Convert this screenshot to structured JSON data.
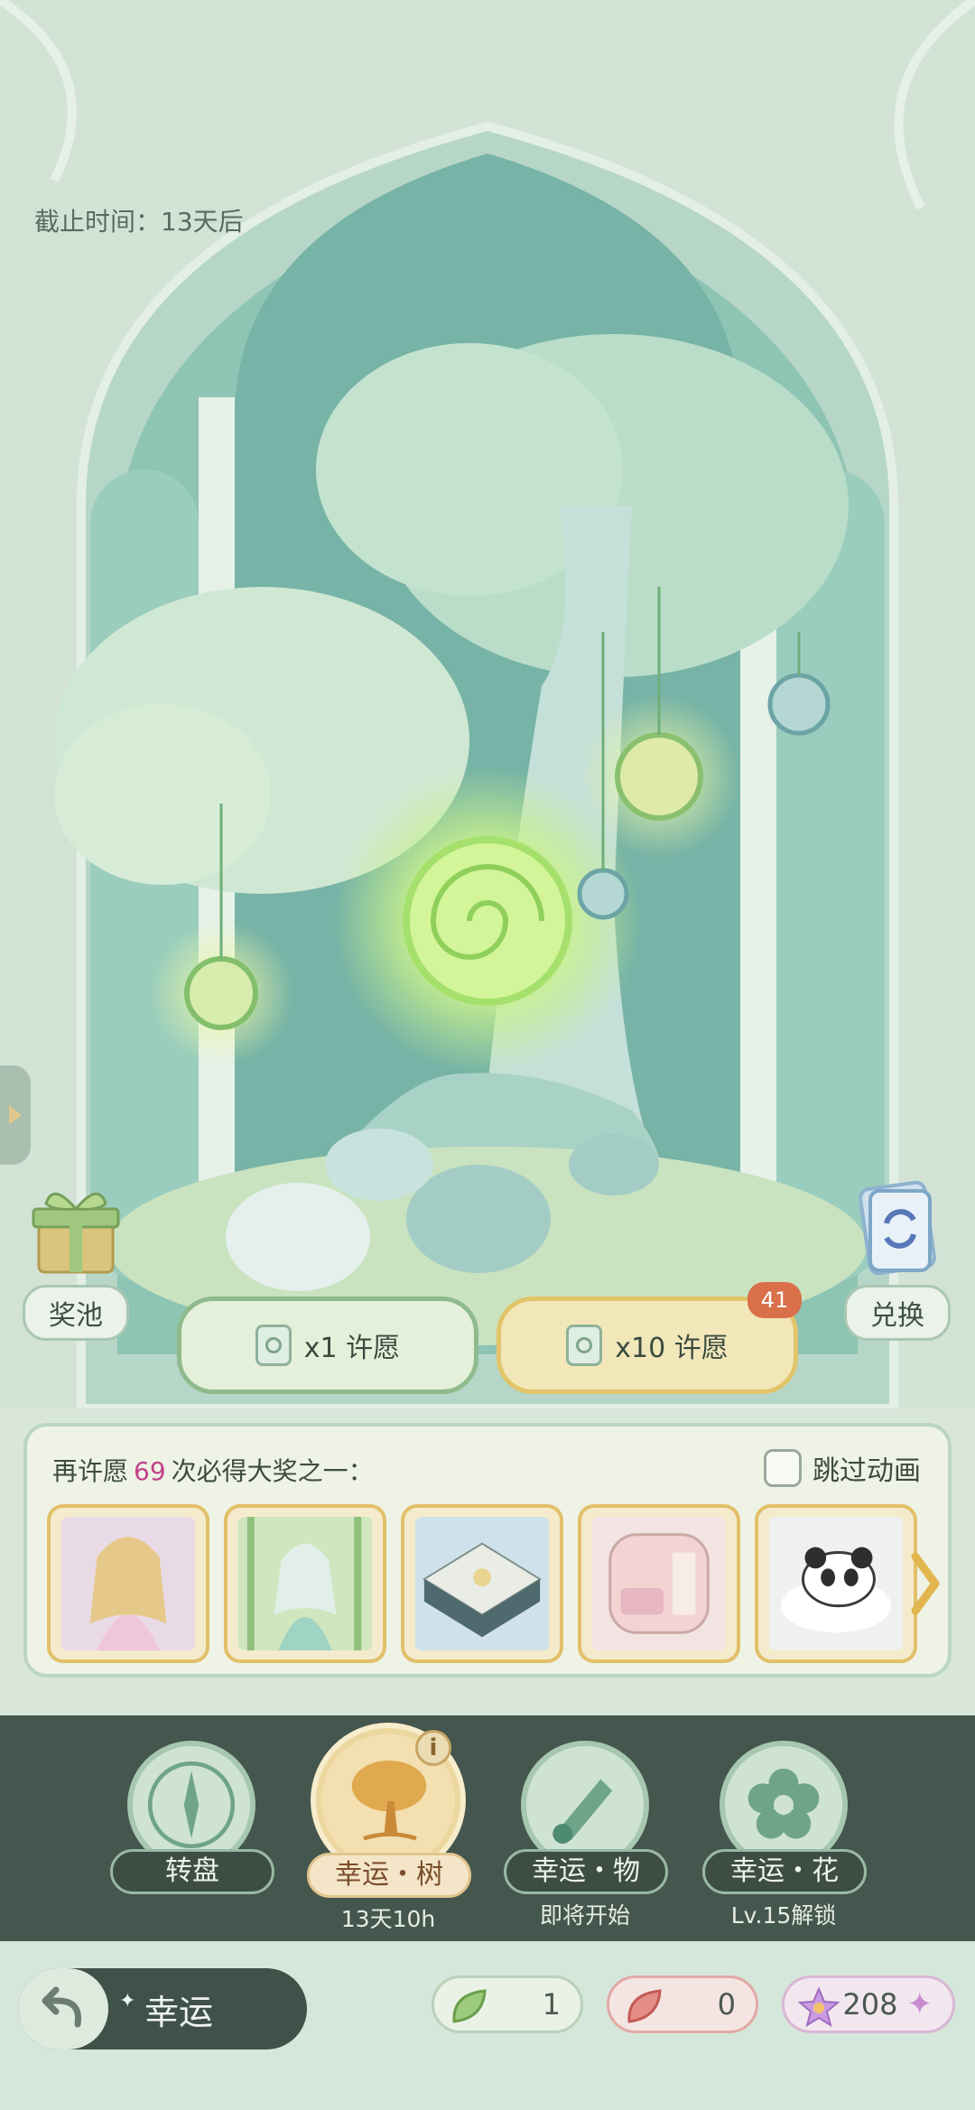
{
  "deadline": "截止时间：13天后",
  "prize_pool": {
    "label": "奖池"
  },
  "exchange": {
    "label": "兑换"
  },
  "wish_buttons": [
    {
      "label": "x1 许愿"
    },
    {
      "label": "x10 许愿",
      "badge": "41"
    }
  ],
  "guarantee": {
    "prefix": "再许愿",
    "count": "69",
    "suffix": "次必得大奖之一：",
    "skip_label": "跳过动画",
    "skip_checked": false,
    "items": [
      {
        "name": "pink-princess-outfit"
      },
      {
        "name": "fairy-bamboo-outfit"
      },
      {
        "name": "garden-pavilion"
      },
      {
        "name": "pink-room-furniture"
      },
      {
        "name": "panda-cloud-cushion"
      }
    ]
  },
  "modes": [
    {
      "name": "转盘",
      "sub": "",
      "active": false
    },
    {
      "name": "幸运・树",
      "sub": "13天10h",
      "active": true
    },
    {
      "name": "幸运・物",
      "sub": "即将开始",
      "active": false
    },
    {
      "name": "幸运・花",
      "sub": "Lv.15解锁",
      "active": false
    }
  ],
  "bottom_nav": {
    "title": "幸运",
    "resources": [
      {
        "icon": "green-leaf-icon",
        "value": "1"
      },
      {
        "icon": "red-leaf-icon",
        "value": "0"
      },
      {
        "icon": "purple-star-icon",
        "value": "208"
      }
    ]
  },
  "colors": {
    "accent_green": "#8fbb8c",
    "accent_gold": "#e2c46a",
    "bar_dark": "#44564d",
    "highlight_pink": "#c2428a"
  }
}
